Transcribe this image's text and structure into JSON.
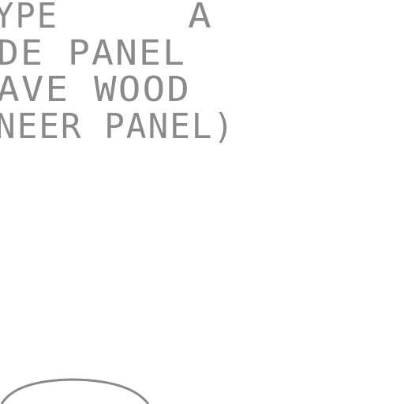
{
  "drawing": {
    "line_color": "#8a8a8a",
    "background": "#ffffff",
    "text_lines": {
      "type_label": "YPE",
      "type_value": "A",
      "line_2": "DE PANEL",
      "line_3": "AVE WOOD",
      "line_4": "NEER PANEL)"
    }
  }
}
